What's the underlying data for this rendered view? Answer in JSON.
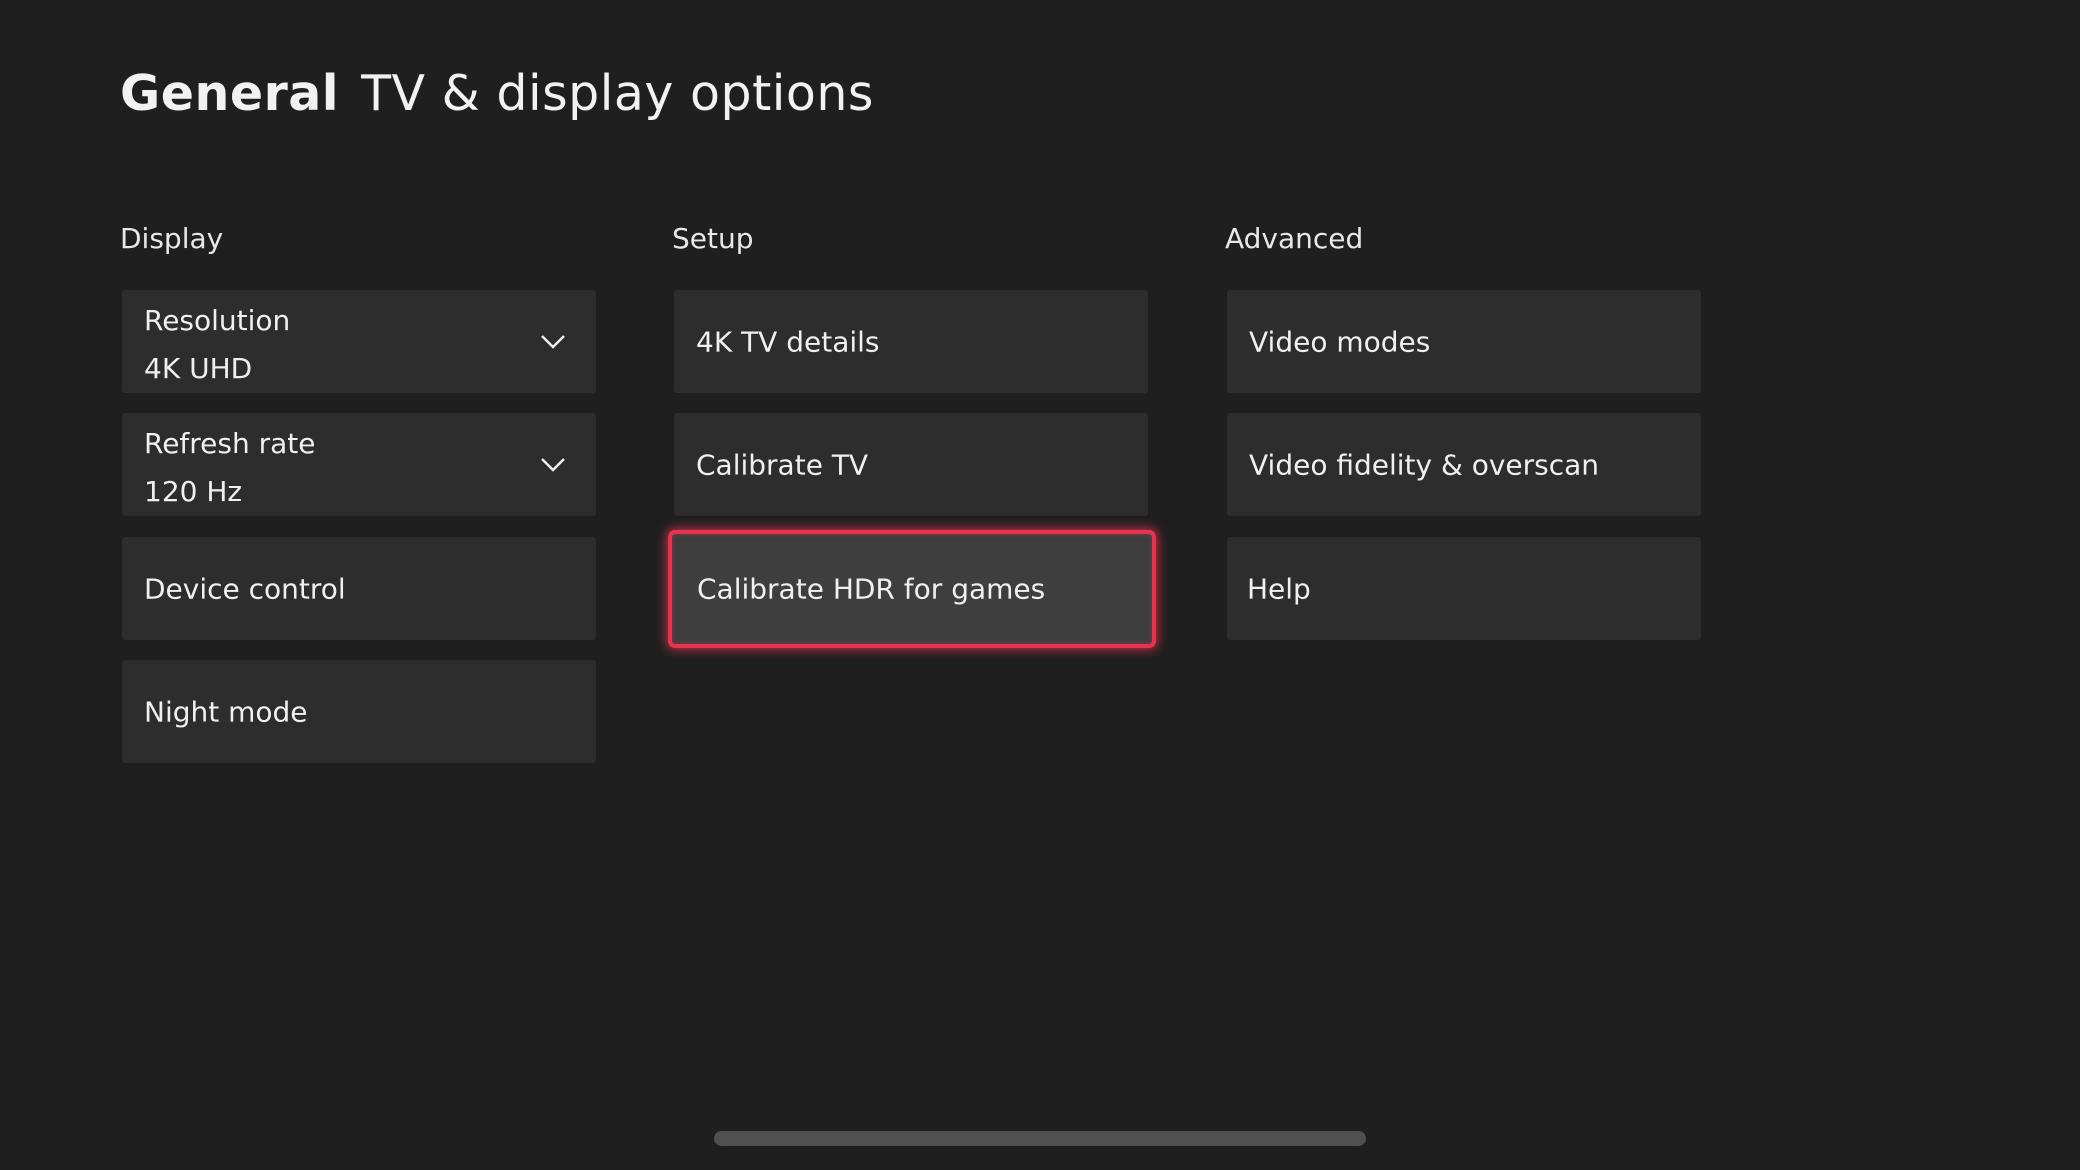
{
  "header": {
    "section": "General",
    "title": "TV & display options"
  },
  "columns": [
    {
      "label": "Display",
      "items": [
        {
          "label": "Resolution",
          "value": "4K UHD",
          "type": "dropdown",
          "icon": "chevron-down-icon"
        },
        {
          "label": "Refresh rate",
          "value": "120 Hz",
          "type": "dropdown",
          "icon": "chevron-down-icon"
        },
        {
          "label": "Device control",
          "type": "button"
        },
        {
          "label": "Night mode",
          "type": "button"
        }
      ]
    },
    {
      "label": "Setup",
      "items": [
        {
          "label": "4K TV details",
          "type": "button"
        },
        {
          "label": "Calibrate TV",
          "type": "button"
        },
        {
          "label": "Calibrate HDR for games",
          "type": "button",
          "focused": true
        }
      ]
    },
    {
      "label": "Advanced",
      "items": [
        {
          "label": "Video modes",
          "type": "button"
        },
        {
          "label": "Video fidelity & overscan",
          "type": "button"
        },
        {
          "label": "Help",
          "type": "button"
        }
      ]
    }
  ],
  "colors": {
    "background": "#1f1f1f",
    "tile": "#2d2d2d",
    "focus": "#e8324f",
    "scrollbar": "#505050"
  }
}
